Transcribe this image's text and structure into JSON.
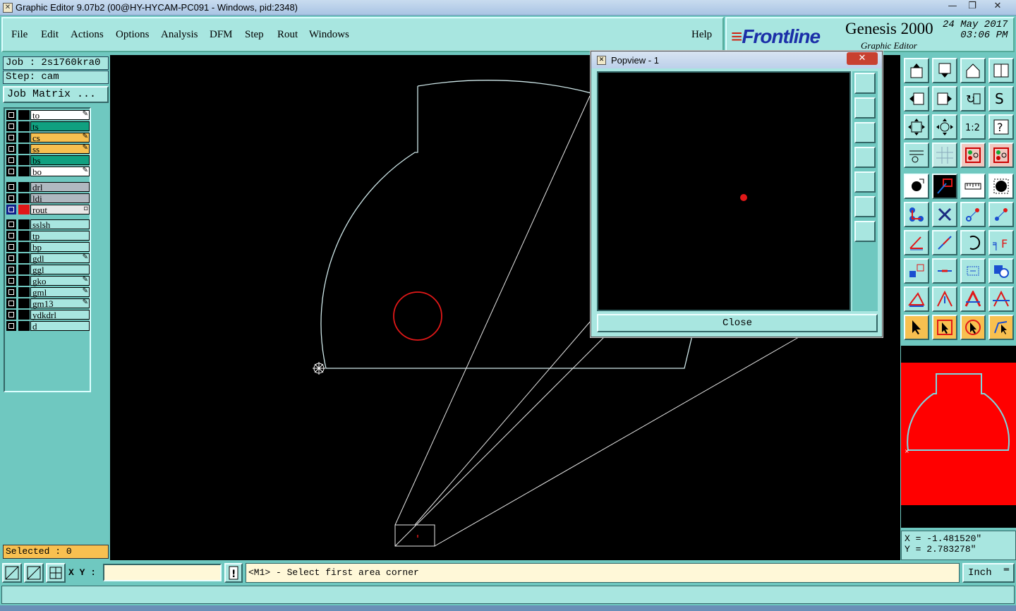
{
  "window": {
    "title": "Graphic Editor 9.07b2 (00@HY-HYCAM-PC091 - Windows, pid:2348)",
    "icon": "app-icon",
    "controls": [
      "minimize",
      "restore",
      "close"
    ]
  },
  "menu": {
    "items": [
      "File",
      "Edit",
      "Actions",
      "Options",
      "Analysis",
      "DFM",
      "Step",
      "Rout",
      "Windows"
    ],
    "help": "Help"
  },
  "brand": {
    "logo": "Frontline",
    "product": "Genesis 2000",
    "subtitle": "Graphic Editor",
    "date_line1": "24 May 2017",
    "date_line2": "03:06 PM"
  },
  "job": {
    "job_label": "Job : 2s1760kra0",
    "step_label": "Step: cam",
    "matrix_button": "Job Matrix ..."
  },
  "layers": [
    {
      "name": "to",
      "color": "#ffffff",
      "mark": "✎"
    },
    {
      "name": "ts",
      "color": "#10a080",
      "mark": ""
    },
    {
      "name": "cs",
      "color": "#f8c050",
      "mark": "✎"
    },
    {
      "name": "ss",
      "color": "#f8c050",
      "mark": "✎"
    },
    {
      "name": "bs",
      "color": "#10a080",
      "mark": ""
    },
    {
      "name": "bo",
      "color": "#ffffff",
      "mark": "✎"
    },
    {
      "name": "drl",
      "color": "#b0b8c0",
      "mark": ""
    },
    {
      "name": "ldi",
      "color": "#b0b8c0",
      "mark": ""
    },
    {
      "name": "rout",
      "color": "#e8e8e8",
      "mark": "▫",
      "active": true
    },
    {
      "name": "sslsh",
      "color": "#a8e6e0",
      "mark": ""
    },
    {
      "name": "tp",
      "color": "#a8e6e0",
      "mark": ""
    },
    {
      "name": "bp",
      "color": "#a8e6e0",
      "mark": ""
    },
    {
      "name": "gdl",
      "color": "#a8e6e0",
      "mark": "✎"
    },
    {
      "name": "ggl",
      "color": "#a8e6e0",
      "mark": ""
    },
    {
      "name": "gko",
      "color": "#a8e6e0",
      "mark": "✎"
    },
    {
      "name": "gml",
      "color": "#a8e6e0",
      "mark": "✎"
    },
    {
      "name": "gm13",
      "color": "#a8e6e0",
      "mark": "✎"
    },
    {
      "name": "ydkdrl",
      "color": "#a8e6e0",
      "mark": ""
    },
    {
      "name": "d",
      "color": "#a8e6e0",
      "mark": ""
    }
  ],
  "selected_label": "Selected : 0",
  "popview": {
    "title": "Popview - 1",
    "close_label": "Close"
  },
  "coords": {
    "x": "X = -1.481520\"",
    "y": "Y = 2.783278\""
  },
  "bottom": {
    "xy_label": "X Y :",
    "xy_value": "",
    "prompt": "<M1> - Select first area corner",
    "units": "Inch"
  }
}
